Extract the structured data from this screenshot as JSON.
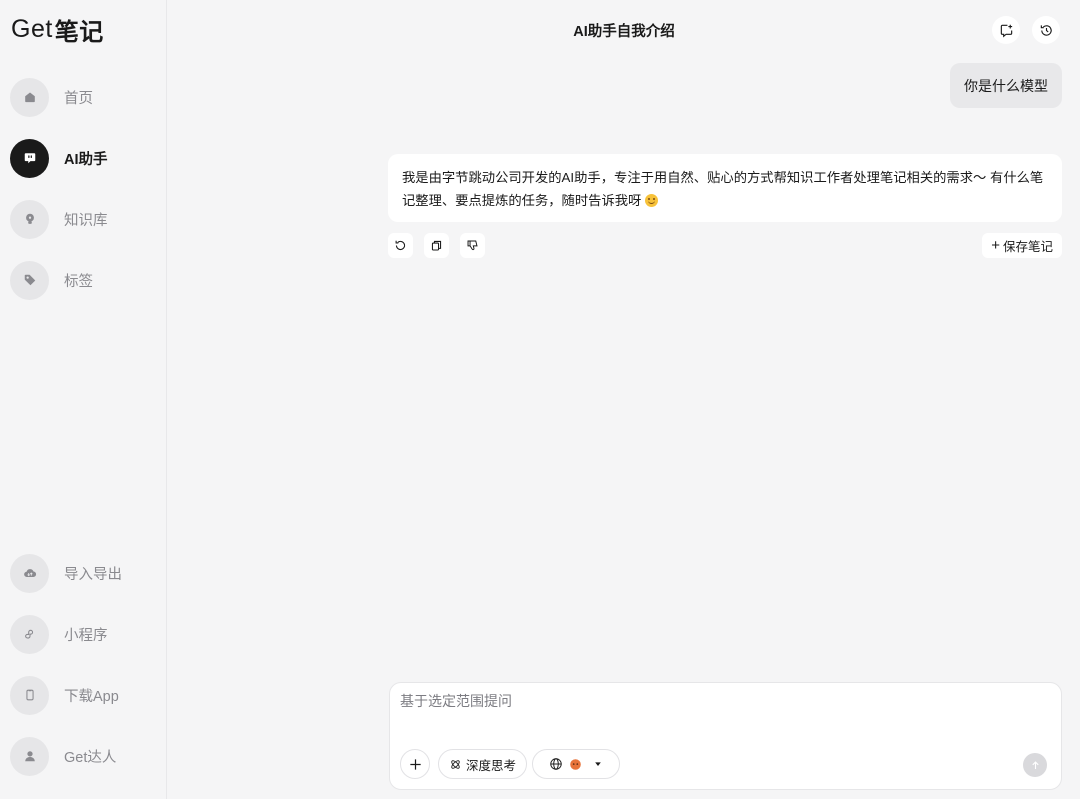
{
  "app": {
    "logo_latin": "Get",
    "logo_cn": "笔记"
  },
  "sidebar": {
    "top_items": [
      {
        "label": "首页",
        "icon": "home-icon",
        "active": false
      },
      {
        "label": "AI助手",
        "icon": "ai-chat-icon",
        "active": true
      },
      {
        "label": "知识库",
        "icon": "lightbulb-icon",
        "active": false
      },
      {
        "label": "标签",
        "icon": "tag-icon",
        "active": false
      }
    ],
    "bottom_items": [
      {
        "label": "导入导出",
        "icon": "cloud-transfer-icon"
      },
      {
        "label": "小程序",
        "icon": "mini-program-icon"
      },
      {
        "label": "下载App",
        "icon": "phone-icon"
      },
      {
        "label": "Get达人",
        "icon": "user-icon"
      }
    ]
  },
  "header": {
    "title": "AI助手自我介绍",
    "new_chat_icon": "new-chat-icon",
    "history_icon": "history-icon"
  },
  "conversation": {
    "user_message": "你是什么模型",
    "ai_message": "我是由字节跳动公司开发的AI助手，专注于用自然、贴心的方式帮知识工作者处理笔记相关的需求～ 有什么笔记整理、要点提炼的任务，随时告诉我呀",
    "ai_emoji": "smile-emoji",
    "actions": {
      "regenerate_icon": "refresh-icon",
      "copy_icon": "copy-icon",
      "dislike_icon": "thumbs-down-icon",
      "save_label": "保存笔记"
    }
  },
  "composer": {
    "placeholder": "基于选定范围提问",
    "deep_think_label": "深度思考",
    "scope_icons": [
      "globe-icon",
      "knowledge-avatar-icon"
    ],
    "send_icon": "arrow-up-icon"
  },
  "colors": {
    "background": "#f5f5f6",
    "active_nav": "#1a1a1a",
    "bubble_user": "#e8e8ea",
    "bubble_ai": "#ffffff"
  }
}
